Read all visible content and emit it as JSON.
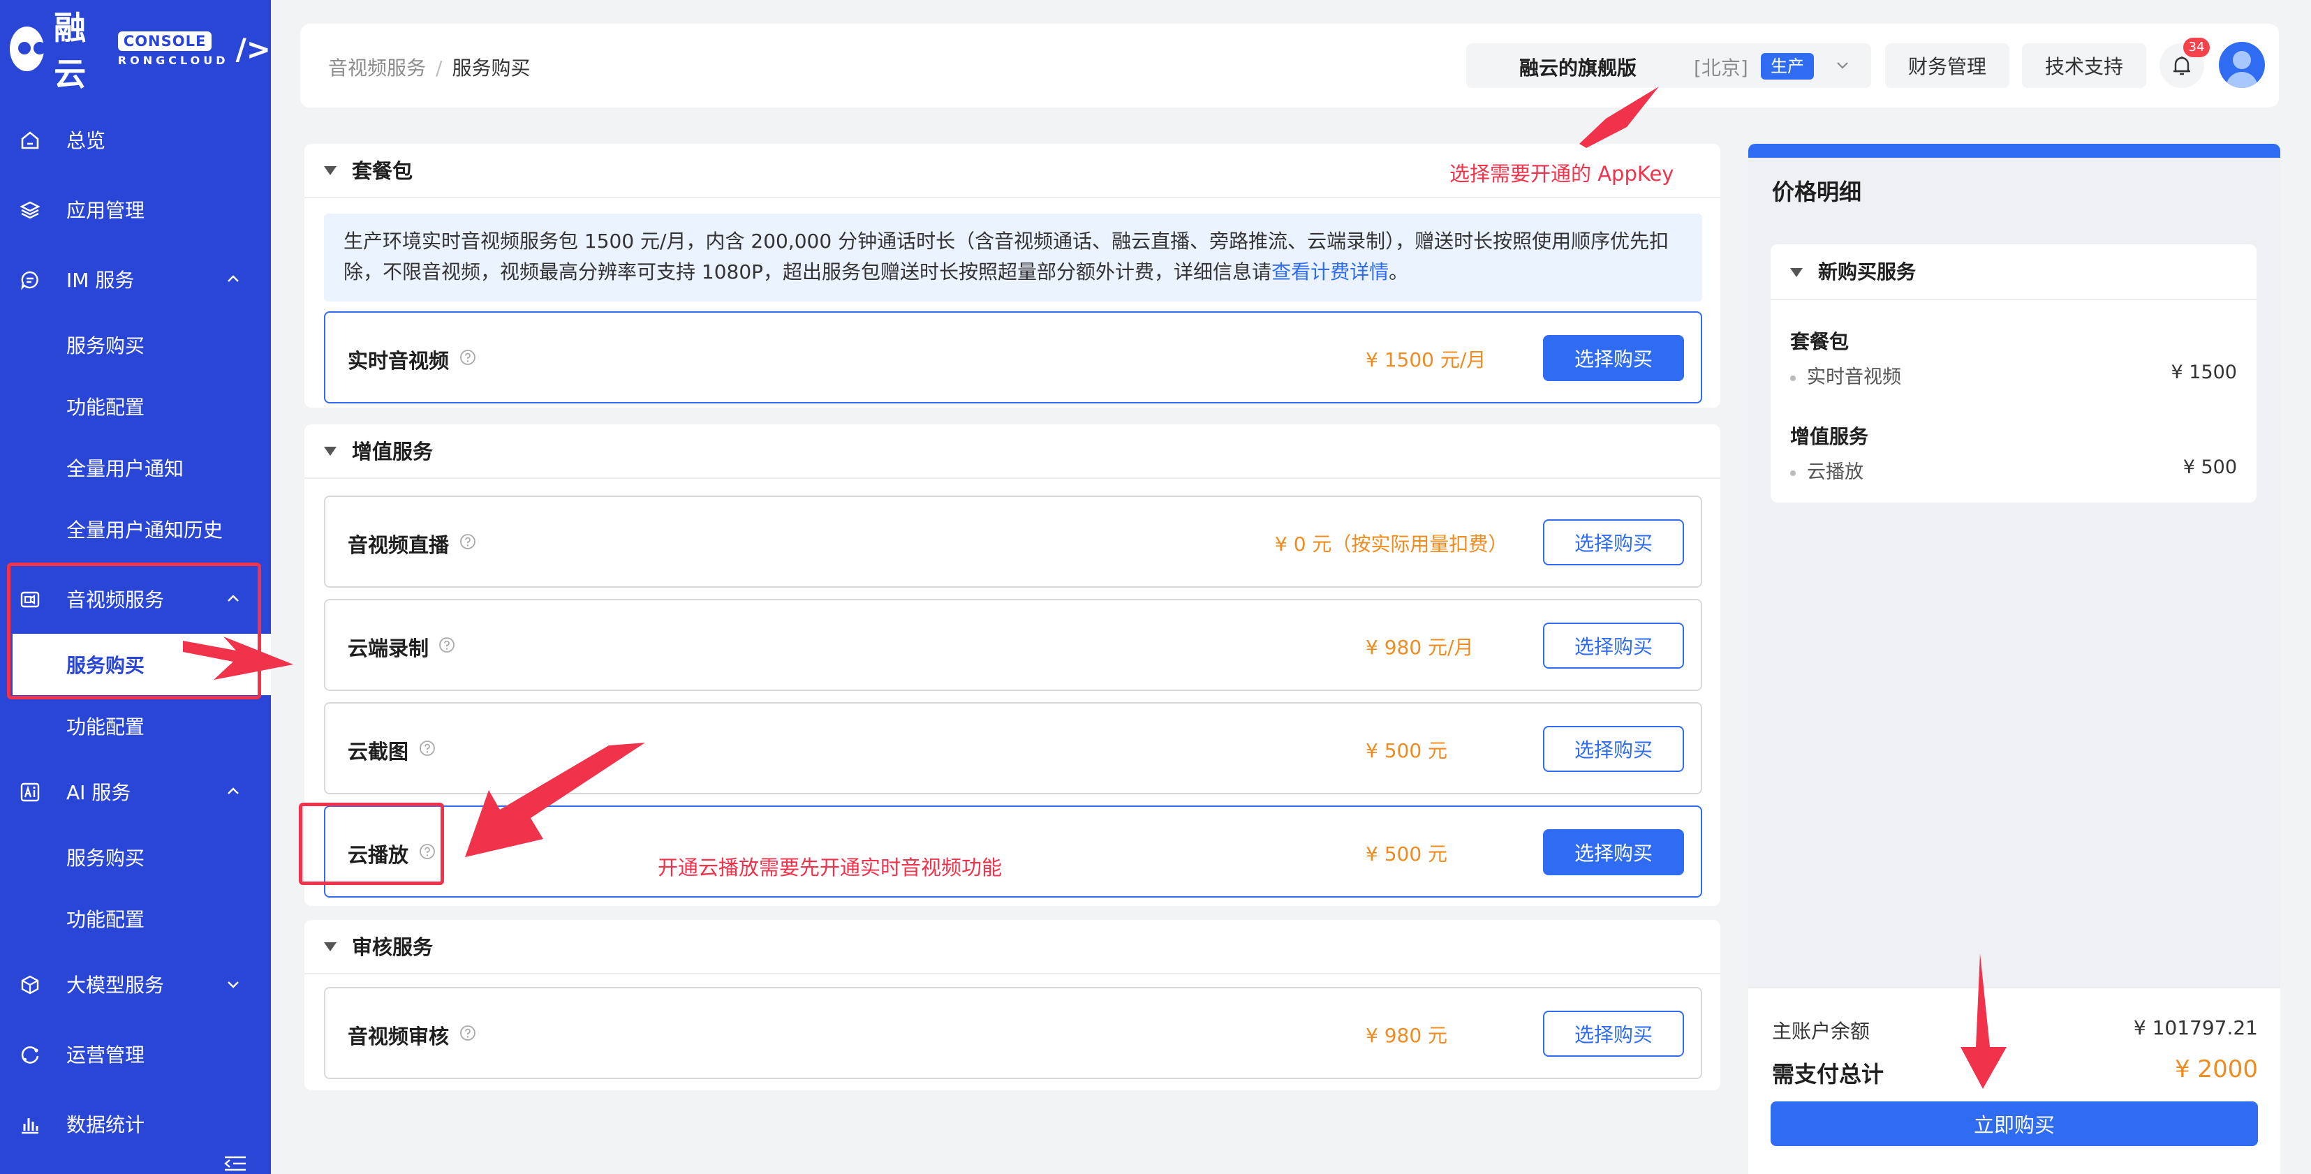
{
  "brand": {
    "name": "融云",
    "console_label": "CONSOLE",
    "sub_label": "RONGCLOUD",
    "slash": "/>"
  },
  "sidebar": {
    "items": [
      {
        "label": "总览",
        "icon": "home-icon"
      },
      {
        "label": "应用管理",
        "icon": "layers-icon"
      },
      {
        "label": "IM 服务",
        "icon": "chat-icon",
        "expanded": true,
        "children": [
          "服务购买",
          "功能配置",
          "全量用户通知",
          "全量用户通知历史"
        ]
      },
      {
        "label": "音视频服务",
        "icon": "video-icon",
        "expanded": true,
        "children": [
          "服务购买",
          "功能配置"
        ],
        "active_child": "服务购买"
      },
      {
        "label": "AI 服务",
        "icon": "ai-icon",
        "expanded": true,
        "children": [
          "服务购买",
          "功能配置"
        ]
      },
      {
        "label": "大模型服务",
        "icon": "model-icon",
        "expanded": false
      },
      {
        "label": "运营管理",
        "icon": "operation-icon"
      },
      {
        "label": "数据统计",
        "icon": "chart-icon"
      }
    ]
  },
  "header": {
    "breadcrumb": [
      "音视频服务",
      "服务购买"
    ],
    "breadcrumb_sep": "/",
    "app_name": "融云的旗舰版",
    "region": "[北京]",
    "env": "生产",
    "finance": "财务管理",
    "support": "技术支持",
    "notification_count": "34"
  },
  "package": {
    "title": "套餐包",
    "info": "生产环境实时音视频服务包 1500 元/月，内含 200,000 分钟通话时长（含音视频通话、融云直播、旁路推流、云端录制），赠送时长按照使用顺序优先扣除，不限音视频，视频最高分辨率可支持 1080P，超出服务包赠送时长按照超量部分额外计费，详细信息请",
    "info_link": "查看计费详情",
    "info_end": "。",
    "card": {
      "name": "实时音视频",
      "price": "¥ 1500 元/月",
      "button": "选择购买"
    }
  },
  "value_added": {
    "title": "增值服务",
    "cards": [
      {
        "name": "音视频直播",
        "price": "¥ 0 元（按实际用量扣费）",
        "button": "选择购买"
      },
      {
        "name": "云端录制",
        "price": "¥ 980 元/月",
        "button": "选择购买"
      },
      {
        "name": "云截图",
        "price": "¥ 500 元",
        "button": "选择购买"
      },
      {
        "name": "云播放",
        "price": "¥ 500 元",
        "button": "选择购买"
      }
    ]
  },
  "review": {
    "title": "审核服务",
    "card": {
      "name": "音视频审核",
      "price": "¥ 980 元",
      "button": "选择购买"
    }
  },
  "price_panel": {
    "title": "价格明细",
    "section": "新购买服务",
    "groups": [
      {
        "name": "套餐包",
        "lines": [
          {
            "label": "实时音视频",
            "amount": "¥ 1500"
          }
        ]
      },
      {
        "name": "增值服务",
        "lines": [
          {
            "label": "云播放",
            "amount": "¥ 500"
          }
        ]
      }
    ]
  },
  "checkout": {
    "balance_label": "主账户余额",
    "balance": "¥ 101797.21",
    "total_label": "需支付总计",
    "total": "¥ 2000",
    "button": "立即购买"
  },
  "annotations": {
    "appkey": "选择需要开通的 AppKey",
    "cloud_play": "开通云播放需要先开通实时音视频功能"
  },
  "colors": {
    "sidebar": "#2a46d6",
    "primary": "#2f6cf2",
    "price": "#f08c1f",
    "annotation": "#f0324a"
  }
}
